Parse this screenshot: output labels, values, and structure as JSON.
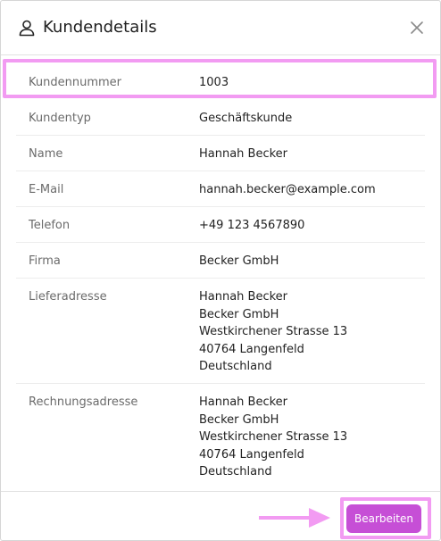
{
  "dialog": {
    "title": "Kundendetails",
    "icon": "user-icon",
    "close_icon": "close-icon"
  },
  "fields": [
    {
      "label": "Kundennummer",
      "value": "1003"
    },
    {
      "label": "Kundentyp",
      "value": "Geschäftskunde"
    },
    {
      "label": "Name",
      "value": "Hannah Becker"
    },
    {
      "label": "E-Mail",
      "value": "hannah.becker@example.com"
    },
    {
      "label": "Telefon",
      "value": "+49 123 4567890"
    },
    {
      "label": "Firma",
      "value": "Becker GmbH"
    },
    {
      "label": "Lieferadresse",
      "value": "Hannah Becker\nBecker GmbH\nWestkirchener Strasse 13\n40764 Langenfeld\nDeutschland"
    },
    {
      "label": "Rechnungsadresse",
      "value": "Hannah Becker\nBecker GmbH\nWestkirchener Strasse 13\n40764 Langenfeld\nDeutschland"
    }
  ],
  "footer": {
    "edit_label": "Bearbeiten"
  },
  "colors": {
    "accent": "#c64fd6",
    "highlight": "#f29bf2"
  }
}
